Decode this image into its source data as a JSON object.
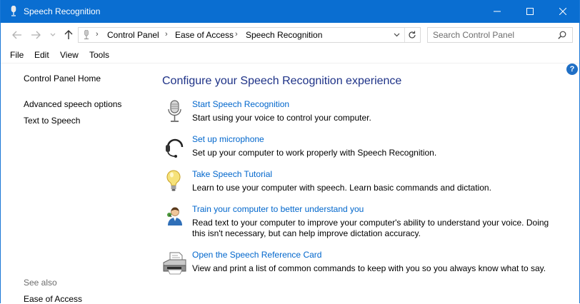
{
  "window": {
    "title": "Speech Recognition"
  },
  "address": {
    "crumbs": [
      "Control Panel",
      "Ease of Access",
      "Speech Recognition"
    ],
    "search_placeholder": "Search Control Panel"
  },
  "menu": [
    "File",
    "Edit",
    "View",
    "Tools"
  ],
  "help_label": "?",
  "sidebar": {
    "home": "Control Panel Home",
    "links": [
      "Advanced speech options",
      "Text to Speech"
    ],
    "see_also_label": "See also",
    "see_also_links": [
      "Ease of Access"
    ]
  },
  "main": {
    "heading": "Configure your Speech Recognition experience",
    "tasks": [
      {
        "icon": "microphone-icon",
        "link": "Start Speech Recognition",
        "desc": "Start using your voice to control your computer."
      },
      {
        "icon": "headset-icon",
        "link": "Set up microphone",
        "desc": "Set up your computer to work properly with Speech Recognition."
      },
      {
        "icon": "lightbulb-icon",
        "link": "Take Speech Tutorial",
        "desc": "Learn to use your computer with speech.  Learn basic commands and dictation."
      },
      {
        "icon": "user-training-icon",
        "link": "Train your computer to better understand you",
        "desc": "Read text to your computer to improve your computer's ability to understand your voice.  Doing this isn't necessary, but can help improve dictation accuracy."
      },
      {
        "icon": "printer-icon",
        "link": "Open the Speech Reference Card",
        "desc": "View and print a list of common commands to keep with you so you always know what to say."
      }
    ]
  },
  "colors": {
    "titlebar": "#0a6ed1",
    "heading": "#1e3287",
    "link": "#0066cc",
    "help": "#1f6fc5"
  }
}
